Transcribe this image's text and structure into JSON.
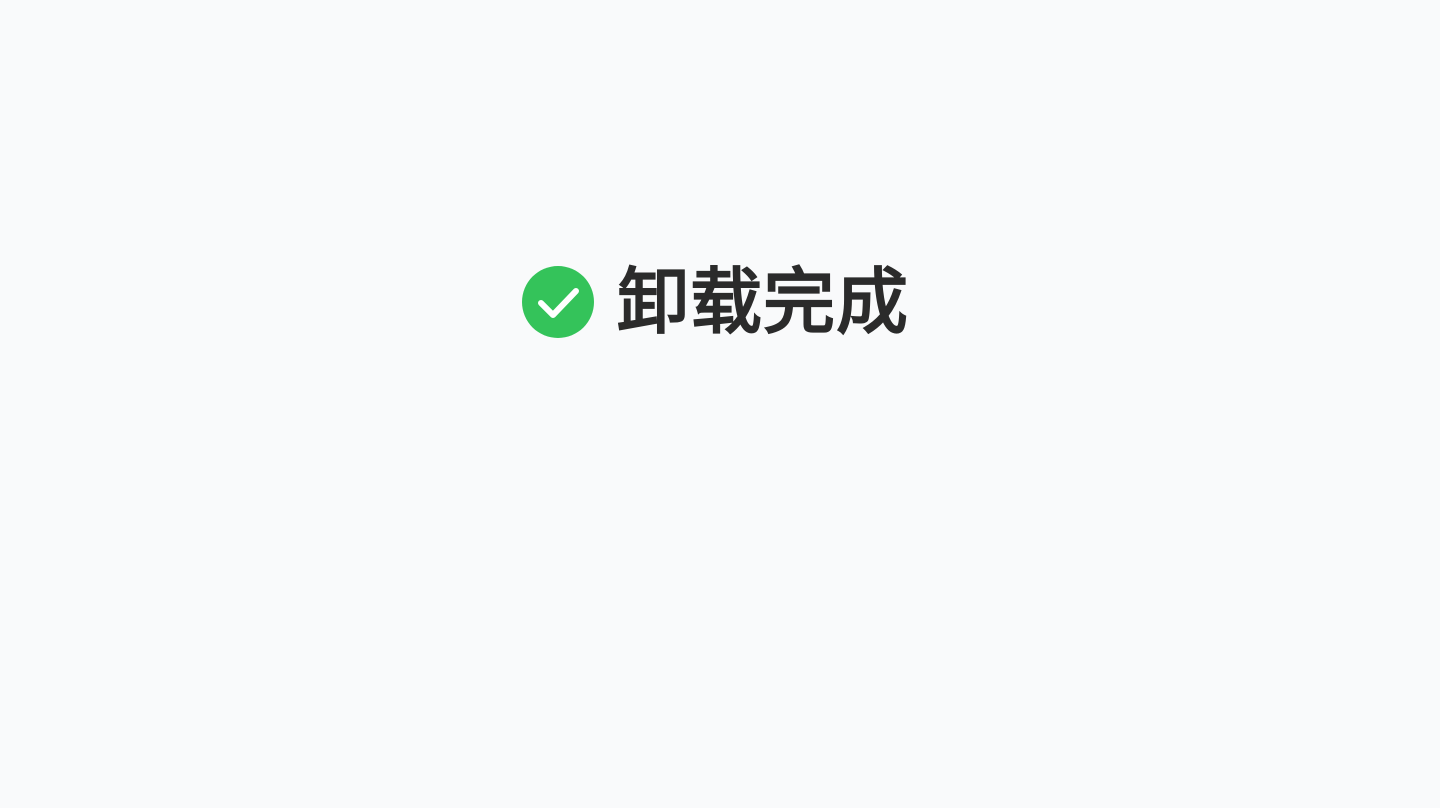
{
  "status": {
    "message": "卸载完成",
    "icon": "check-circle-icon",
    "accent_color": "#34c35a",
    "text_color": "#2b2b2b",
    "background_color": "#f9fafb"
  }
}
